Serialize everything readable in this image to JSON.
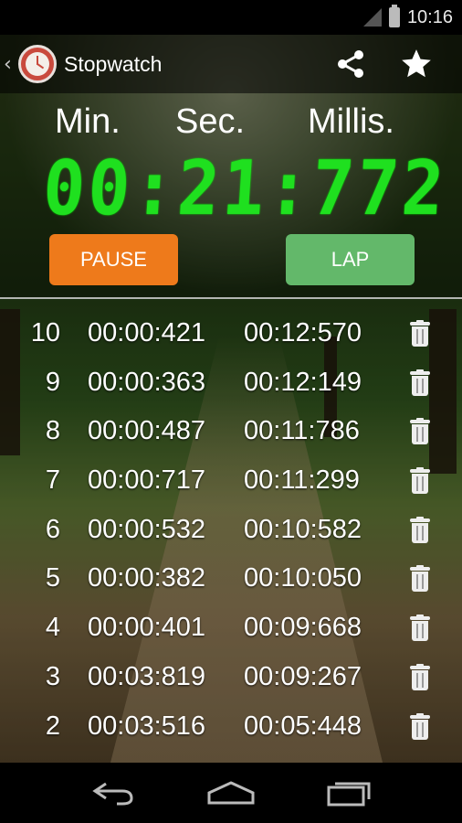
{
  "status_bar": {
    "time": "10:16"
  },
  "action_bar": {
    "title": "Stopwatch",
    "icons": [
      "clock-app-icon",
      "share-icon",
      "star-icon"
    ]
  },
  "display": {
    "labels": {
      "minutes": "Min.",
      "seconds": "Sec.",
      "millis": "Millis."
    },
    "value": "00:21:772",
    "color": "#1fe01f"
  },
  "buttons": {
    "pause_label": "PAUSE",
    "pause_color": "#ee7a1b",
    "lap_label": "LAP",
    "lap_color": "#63b86a"
  },
  "laps": [
    {
      "num": "10",
      "split": "00:00:421",
      "total": "00:12:570"
    },
    {
      "num": "9",
      "split": "00:00:363",
      "total": "00:12:149"
    },
    {
      "num": "8",
      "split": "00:00:487",
      "total": "00:11:786"
    },
    {
      "num": "7",
      "split": "00:00:717",
      "total": "00:11:299"
    },
    {
      "num": "6",
      "split": "00:00:532",
      "total": "00:10:582"
    },
    {
      "num": "5",
      "split": "00:00:382",
      "total": "00:10:050"
    },
    {
      "num": "4",
      "split": "00:00:401",
      "total": "00:09:668"
    },
    {
      "num": "3",
      "split": "00:03:819",
      "total": "00:09:267"
    },
    {
      "num": "2",
      "split": "00:03:516",
      "total": "00:05:448"
    }
  ],
  "nav": [
    "back-icon",
    "home-icon",
    "recents-icon"
  ]
}
